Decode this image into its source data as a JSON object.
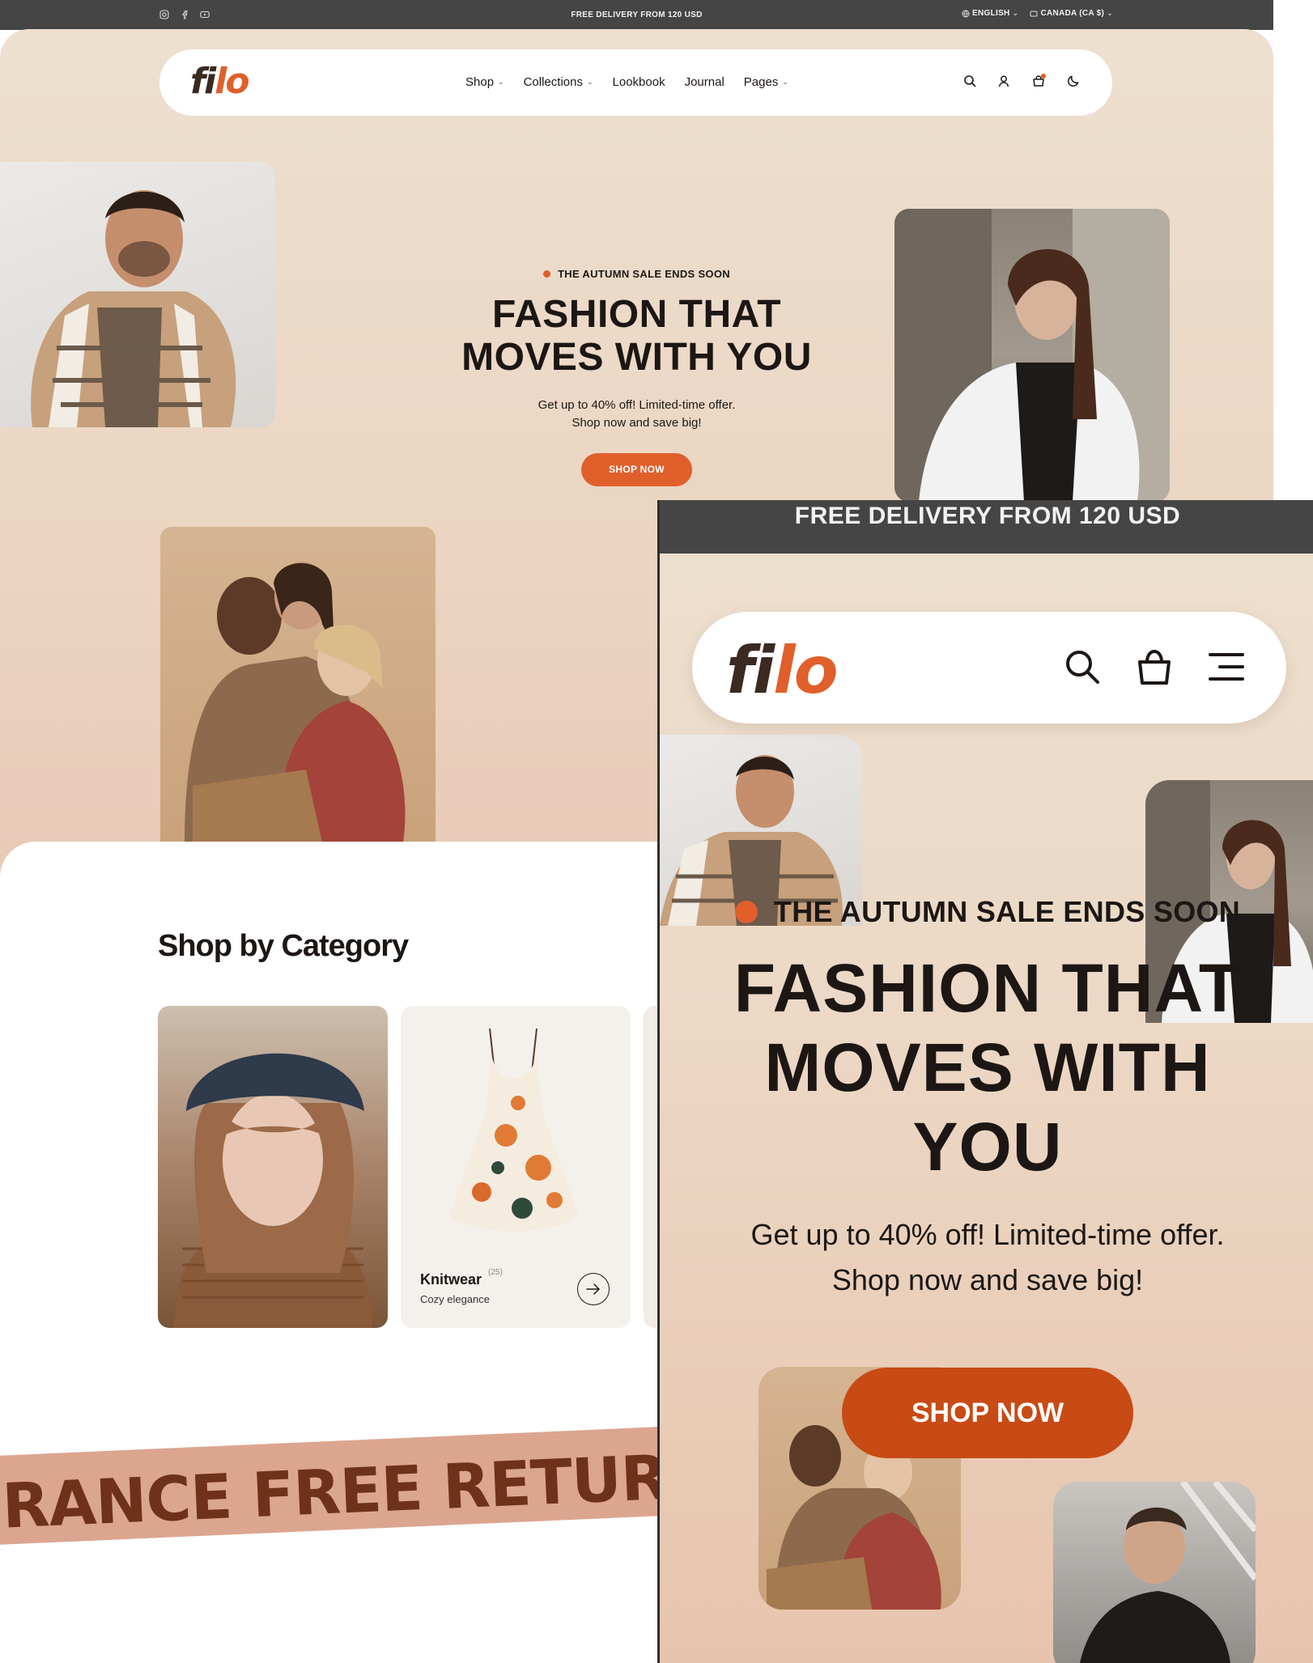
{
  "desktop": {
    "topbar": {
      "social_icons": [
        "instagram-icon",
        "facebook-icon",
        "youtube-icon"
      ],
      "promo": "FREE DELIVERY FROM 120 USD",
      "language": "ENGLISH",
      "currency": "CANADA (CA $)"
    },
    "nav": {
      "logo_a": "fi",
      "logo_b": "lo",
      "links": [
        {
          "label": "Shop",
          "dropdown": true
        },
        {
          "label": "Collections",
          "dropdown": true
        },
        {
          "label": "Lookbook",
          "dropdown": false
        },
        {
          "label": "Journal",
          "dropdown": false
        },
        {
          "label": "Pages",
          "dropdown": true
        }
      ],
      "icons": [
        "search-icon",
        "user-icon",
        "cart-icon",
        "dark-mode-icon"
      ]
    },
    "hero": {
      "eyebrow": "THE AUTUMN SALE ENDS SOON",
      "title_line1": "FASHION THAT",
      "title_line2": "MOVES WITH YOU",
      "sub_line1": "Get up to 40% off! Limited-time offer.",
      "sub_line2": "Shop now and save big!",
      "cta": "SHOP NOW"
    },
    "categories": {
      "title": "Shop by Category",
      "cards": [
        {
          "name": "Knitwear",
          "count": "(25)",
          "desc": "Cozy elegance"
        }
      ]
    },
    "marquee": "RANCE FREE RETURNS"
  },
  "mobile": {
    "topbar": "FREE DELIVERY FROM 120 USD",
    "logo_a": "fi",
    "logo_b": "lo",
    "icons": [
      "search-icon",
      "cart-icon",
      "menu-icon"
    ],
    "eyebrow": "THE AUTUMN SALE ENDS SOON",
    "title_line1": "FASHION THAT",
    "title_line2": "MOVES WITH",
    "title_line3": "YOU",
    "sub_line1": "Get up to 40% off! Limited-time offer.",
    "sub_line2": "Shop now and save big!",
    "cta": "SHOP NOW"
  },
  "colors": {
    "accent": "#e05f2b",
    "accent_dark": "#c84a14",
    "topbar": "#454545",
    "hero_bg": "#ede0cf",
    "marquee_bg": "#dca590",
    "marquee_text": "#6e321a"
  }
}
